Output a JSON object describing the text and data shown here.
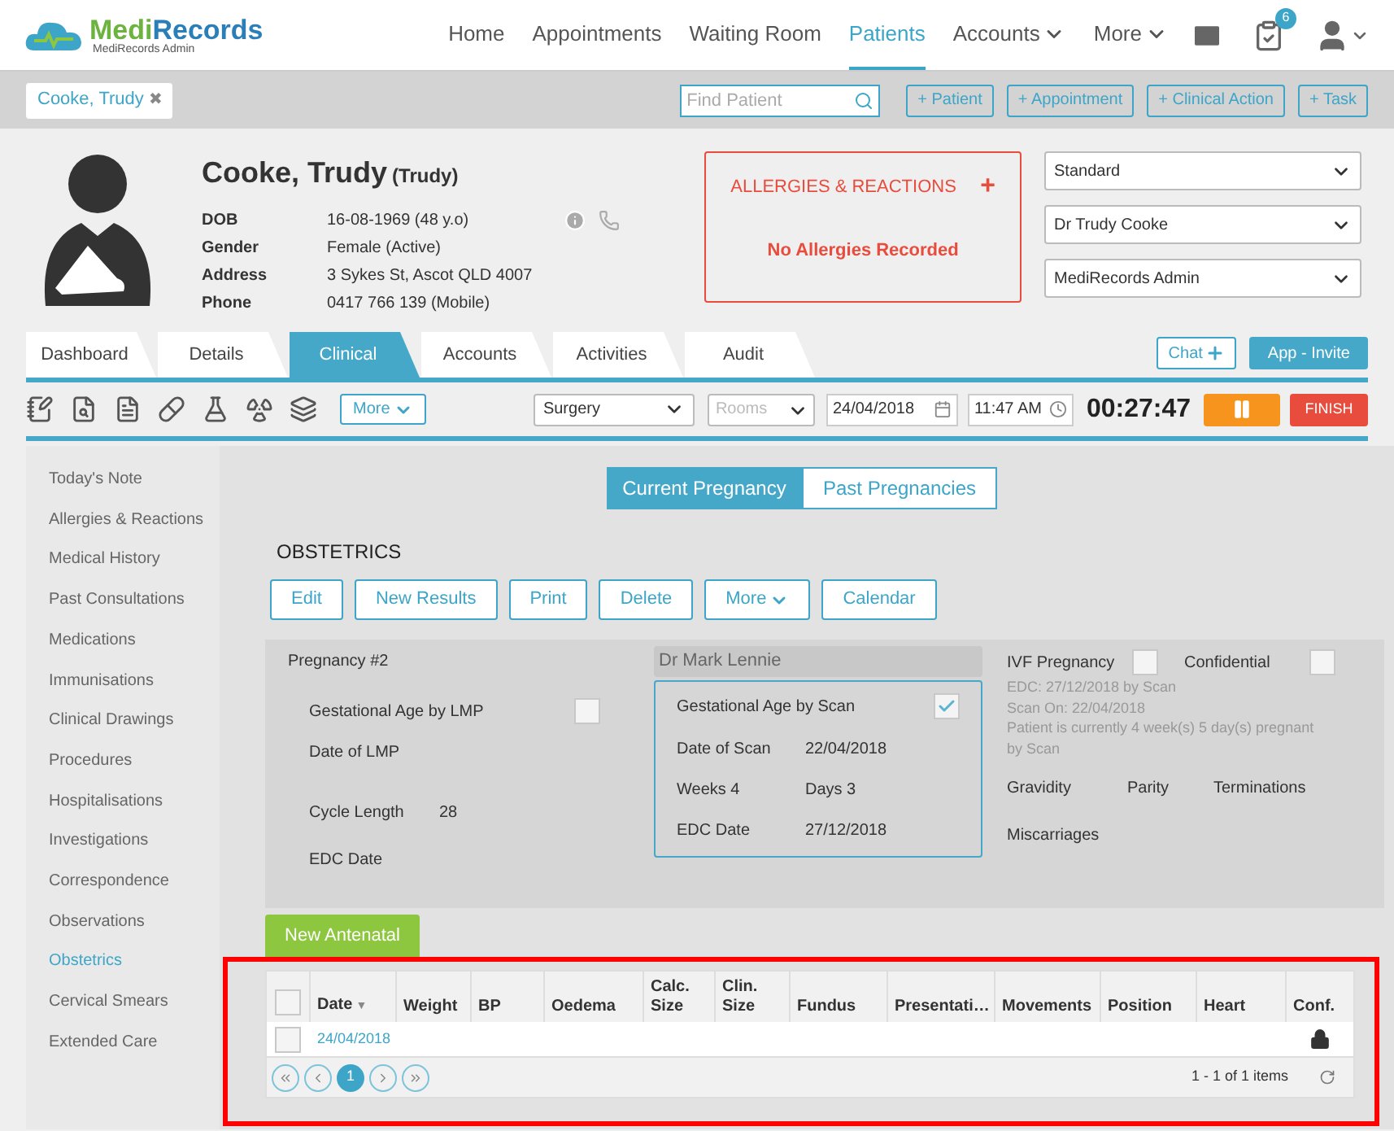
{
  "header": {
    "logo": {
      "name_parts": [
        "Medi",
        "Records"
      ],
      "subtitle": "MediRecords Admin"
    },
    "nav": [
      {
        "label": "Home",
        "selected": false,
        "caret": false
      },
      {
        "label": "Appointments",
        "selected": false,
        "caret": false
      },
      {
        "label": "Waiting Room",
        "selected": false,
        "caret": false
      },
      {
        "label": "Patients",
        "selected": true,
        "caret": false
      },
      {
        "label": "Accounts",
        "selected": false,
        "caret": true
      },
      {
        "label": "More",
        "selected": false,
        "caret": true
      }
    ],
    "tasks_badge": "6"
  },
  "patient_bar": {
    "open_patient": "Cooke, Trudy",
    "close": "✖",
    "search": {
      "placeholder": "Find Patient"
    },
    "actions": [
      "+ Patient",
      "+ Appointment",
      "+ Clinical Action",
      "+ Task"
    ]
  },
  "patient": {
    "name": "Cooke, Trudy",
    "preferred": "(Trudy)",
    "details": [
      {
        "label": "DOB",
        "value": "16-08-1969 (48 y.o)"
      },
      {
        "label": "Gender",
        "value": "Female (Active)"
      },
      {
        "label": "Address",
        "value": "3 Sykes St, Ascot QLD 4007"
      },
      {
        "label": "Phone",
        "value": "0417 766 139 (Mobile)"
      }
    ]
  },
  "allergies": {
    "title": "ALLERGIES & REACTIONS",
    "add": "+",
    "message": "No Allergies Recorded"
  },
  "selects": [
    "Standard",
    "Dr Trudy Cooke",
    "MediRecords Admin"
  ],
  "tabs": [
    {
      "label": "Dashboard",
      "selected": false
    },
    {
      "label": "Details",
      "selected": false
    },
    {
      "label": "Clinical",
      "selected": true
    },
    {
      "label": "Accounts",
      "selected": false
    },
    {
      "label": "Activities",
      "selected": false
    },
    {
      "label": "Audit",
      "selected": false
    }
  ],
  "tab_actions": {
    "chat": "Chat",
    "invite": "App - Invite"
  },
  "toolbar": {
    "more": "More",
    "location": "Surgery",
    "rooms": {
      "placeholder": "Rooms"
    },
    "date": "24/04/2018",
    "time": "11:47 AM",
    "timer": "00:27:47",
    "finish": "FINISH"
  },
  "sidebar": {
    "items": [
      {
        "label": "Today's Note",
        "selected": false
      },
      {
        "label": "Allergies & Reactions",
        "selected": false
      },
      {
        "label": "Medical History",
        "selected": false
      },
      {
        "label": "Past Consultations",
        "selected": false
      },
      {
        "label": "Medications",
        "selected": false
      },
      {
        "label": "Immunisations",
        "selected": false
      },
      {
        "label": "Clinical Drawings",
        "selected": false
      },
      {
        "label": "Procedures",
        "selected": false
      },
      {
        "label": "Hospitalisations",
        "selected": false
      },
      {
        "label": "Investigations",
        "selected": false
      },
      {
        "label": "Correspondence",
        "selected": false
      },
      {
        "label": "Observations",
        "selected": false
      },
      {
        "label": "Obstetrics",
        "selected": true
      },
      {
        "label": "Cervical Smears",
        "selected": false
      },
      {
        "label": "Extended Care",
        "selected": false
      }
    ]
  },
  "pregnancy_toggle": [
    {
      "label": "Current Pregnancy",
      "selected": true
    },
    {
      "label": "Past Pregnancies",
      "selected": false
    }
  ],
  "section_title": "OBSTETRICS",
  "actions": [
    {
      "label": "Edit",
      "caret": false
    },
    {
      "label": "New Results",
      "caret": false
    },
    {
      "label": "Print",
      "caret": false
    },
    {
      "label": "Delete",
      "caret": false
    },
    {
      "label": "More",
      "caret": true
    },
    {
      "label": "Calendar",
      "caret": false
    }
  ],
  "pregnancy": {
    "title": "Pregnancy #2",
    "lmp": {
      "label": "Gestational Age by LMP",
      "checked": false
    },
    "date_of_lmp": "Date of LMP",
    "cycle_length": {
      "label": "Cycle Length",
      "value": "28"
    },
    "edc": "EDC Date",
    "doctor": "Dr Mark Lennie",
    "scan": {
      "label": "Gestational Age by Scan",
      "checked": true
    },
    "scan_rows": [
      {
        "label": "Date of Scan",
        "value": "22/04/2018"
      },
      {
        "label": "Weeks 4",
        "value": "Days 3"
      },
      {
        "label": "EDC Date",
        "value": "27/12/2018"
      }
    ],
    "flags": [
      {
        "label": "IVF Pregnancy",
        "checked": false
      },
      {
        "label": "Confidential",
        "checked": false
      }
    ],
    "notes": [
      "EDC: 27/12/2018 by Scan",
      "Scan On: 22/04/2018",
      "Patient is currently 4 week(s) 5 day(s) pregnant by Scan"
    ],
    "stats": [
      "Gravidity",
      "Parity",
      "Terminations",
      "Miscarriages"
    ]
  },
  "new_antenatal": "New Antenatal",
  "table": {
    "columns": [
      "Date",
      "Weight",
      "BP",
      "Oedema",
      "Calc. Size",
      "Clin. Size",
      "Fundus",
      "Presentati…",
      "Movements",
      "Position",
      "Heart",
      "Conf."
    ],
    "sort_marker": "▼",
    "header_checked": false,
    "rows": [
      {
        "checked": false,
        "date": "24/04/2018",
        "locked": true
      }
    ],
    "pages": [
      {
        "label": "1",
        "selected": true
      }
    ],
    "summary": "1 - 1 of 1 items"
  }
}
